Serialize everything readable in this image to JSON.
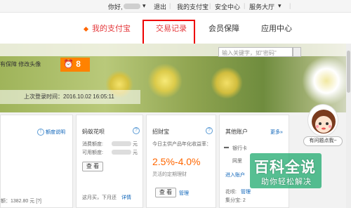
{
  "topbar": {
    "greeting": "你好,",
    "logout": "退出",
    "my_alipay": "我的支付宝",
    "security": "安全中心",
    "service": "服务大厅"
  },
  "nav": {
    "my_alipay": "我的支付宝",
    "transactions": "交易记录",
    "membership": "会员保障",
    "apps": "应用中心"
  },
  "search": {
    "placeholder": "输入关键字，如\"密码\""
  },
  "hero": {
    "protection": "有保障 修改头像",
    "alarm_count": "8",
    "last_login": "上次登录时间：2016.10.02 16:05:11"
  },
  "balance_card": {
    "quota_link": "额度说明",
    "balance": "额：1382.80 元 [?]"
  },
  "huabei_card": {
    "title": "蚂蚁花呗",
    "spent": "消费额度:",
    "available": "可用额度:",
    "yuan1": "元",
    "yuan2": "元",
    "view": "查 看",
    "next_due": "这月买，下月还",
    "details": "详情"
  },
  "zhaocai_card": {
    "title": "招财宝",
    "desc": "今日主供产品年化收益率：",
    "rate": "2.5%-4.0%",
    "note": "灵活的定期理财",
    "view": "查 看",
    "manage": "管理"
  },
  "other_card": {
    "title": "其他账户",
    "more": "更多»",
    "bank": "银行卡",
    "net_bank": "网里",
    "enter": "进入账户",
    "huabei": "花呗:",
    "manage": "管理",
    "jifen": "集分宝: 2"
  },
  "assistant": {
    "ask": "有问题点我~"
  },
  "watermark": {
    "title": "百科全说",
    "subtitle": "助你轻松解决"
  }
}
